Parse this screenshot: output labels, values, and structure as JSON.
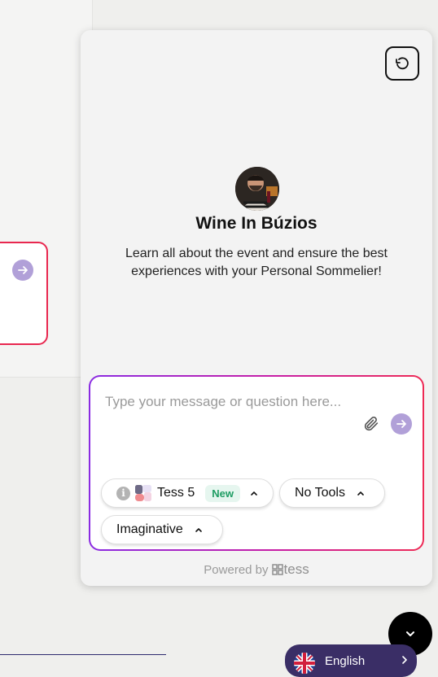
{
  "widget": {
    "title": "Wine In Búzios",
    "description": "Learn all about the event and ensure the best experiences with your Personal Sommelier!",
    "reset_icon": "refresh-icon"
  },
  "composer": {
    "placeholder": "Type your message or question here...",
    "value": "",
    "attach_icon": "paperclip-icon",
    "send_icon": "arrow-right-icon"
  },
  "chips": {
    "model": {
      "info_icon": "info-icon",
      "label": "Tess 5",
      "badge": "New"
    },
    "tools": {
      "label": "No Tools"
    },
    "mode": {
      "label": "Imaginative"
    }
  },
  "footer": {
    "powered_by": "Powered by",
    "brand": "tess"
  },
  "language": {
    "label": "English",
    "flag": "uk-flag-icon"
  },
  "colors": {
    "accent_gradient_start": "#8a2be2",
    "accent_gradient_end": "#ee2a55",
    "send_button": "#b1a0d8",
    "new_badge_text": "#1f9d63",
    "language_button": "#3a2e66"
  }
}
